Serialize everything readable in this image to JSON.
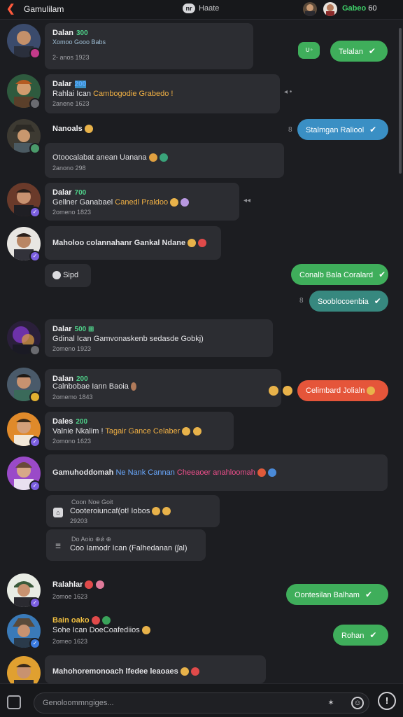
{
  "app": {
    "title": "Gamulilam",
    "center_title": "Haate",
    "center_icon_text": "nr",
    "status_label": "Gabeo",
    "status_count": "60"
  },
  "colors": {
    "bg": "#1c1d21",
    "incoming": "#2c2d32",
    "green": "#3fae5b",
    "blue": "#3a8fc4",
    "teal": "#37887f",
    "red": "#e5553a",
    "accent": "#ff5a3c"
  },
  "messages": [
    {
      "name": "Dalan",
      "tag": "300",
      "text": "Xomoo Gooo Babs",
      "time": "2- anos 1923"
    },
    {
      "name": "Dalar",
      "tag": "200",
      "text_a": "Rahlai Ican ",
      "text_b": "Cambogodie Grabedo",
      "text_c": "!",
      "time": "2anene 1623"
    },
    {
      "name": "Nanoals",
      "text": "",
      "time": ""
    },
    {
      "name": "",
      "text": "Otoocalabat anean Uanana",
      "time": "2anono 298"
    },
    {
      "name": "Dalar",
      "tag": "700",
      "text_a": "Gellner Ganabael ",
      "text_b": "Canedl Praldoo",
      "time": "2omeno 1823"
    },
    {
      "name": "",
      "text": "Maholoo colannahanr Gankal Ndane",
      "time": ""
    },
    {
      "name": "",
      "text": "Sipd",
      "time": ""
    },
    {
      "name": "Dalar",
      "tag": "500 ⊞",
      "text": "Gdinal Ican Gamvonaskenb sedasde Gobkj)",
      "time": "2omeno 1923"
    },
    {
      "name": "Dalan",
      "tag": "200",
      "text": "Calnbobae Iann Baoia",
      "time": "2omemo 1843"
    },
    {
      "name": "Dales",
      "tag": "200",
      "text_a": "Valnie Nkalim ! ",
      "text_b": "Tagair Gance Celaber",
      "time": "2omono 1623"
    },
    {
      "name": "Gamuhoddomah",
      "text_a": "Ne Nank Cannan ",
      "text_b": "Cheeaoer anahloomah"
    },
    {
      "file_title": "Coon Noe   Goit",
      "text": "Cooteroiuncaf(ot! Iobos",
      "time": "29203"
    },
    {
      "file_title": "Do Aoio  ⊕ǿ  ⊕",
      "text": "Coo Iamodr Ican (Falhedanan (ʃal)"
    },
    {
      "name": "Ralahlar",
      "text": "",
      "time": "2omoe 1623"
    },
    {
      "name": "Bain oako",
      "text": "Sohe Ican DoeCoafediios",
      "time": "2omeo 1623"
    },
    {
      "name": "",
      "text": "Mahohoremonoach lfedee leaoaes"
    }
  ],
  "outgoing": [
    {
      "text": "∪◦"
    },
    {
      "text": "Telalan"
    },
    {
      "text": "Stalmgan Raliool"
    },
    {
      "text": "Conalb Bala Coralard"
    },
    {
      "text": "Sooblocoenbia"
    },
    {
      "text": "Celimbard Jolialn"
    },
    {
      "text": "Oontesilan Balham"
    },
    {
      "text": "Rohan"
    }
  ],
  "side_marks": {
    "a": "◂ •",
    "b": "8",
    "c": "◂◂",
    "d": "8"
  },
  "compose": {
    "placeholder": "Genoloommngiges..."
  }
}
